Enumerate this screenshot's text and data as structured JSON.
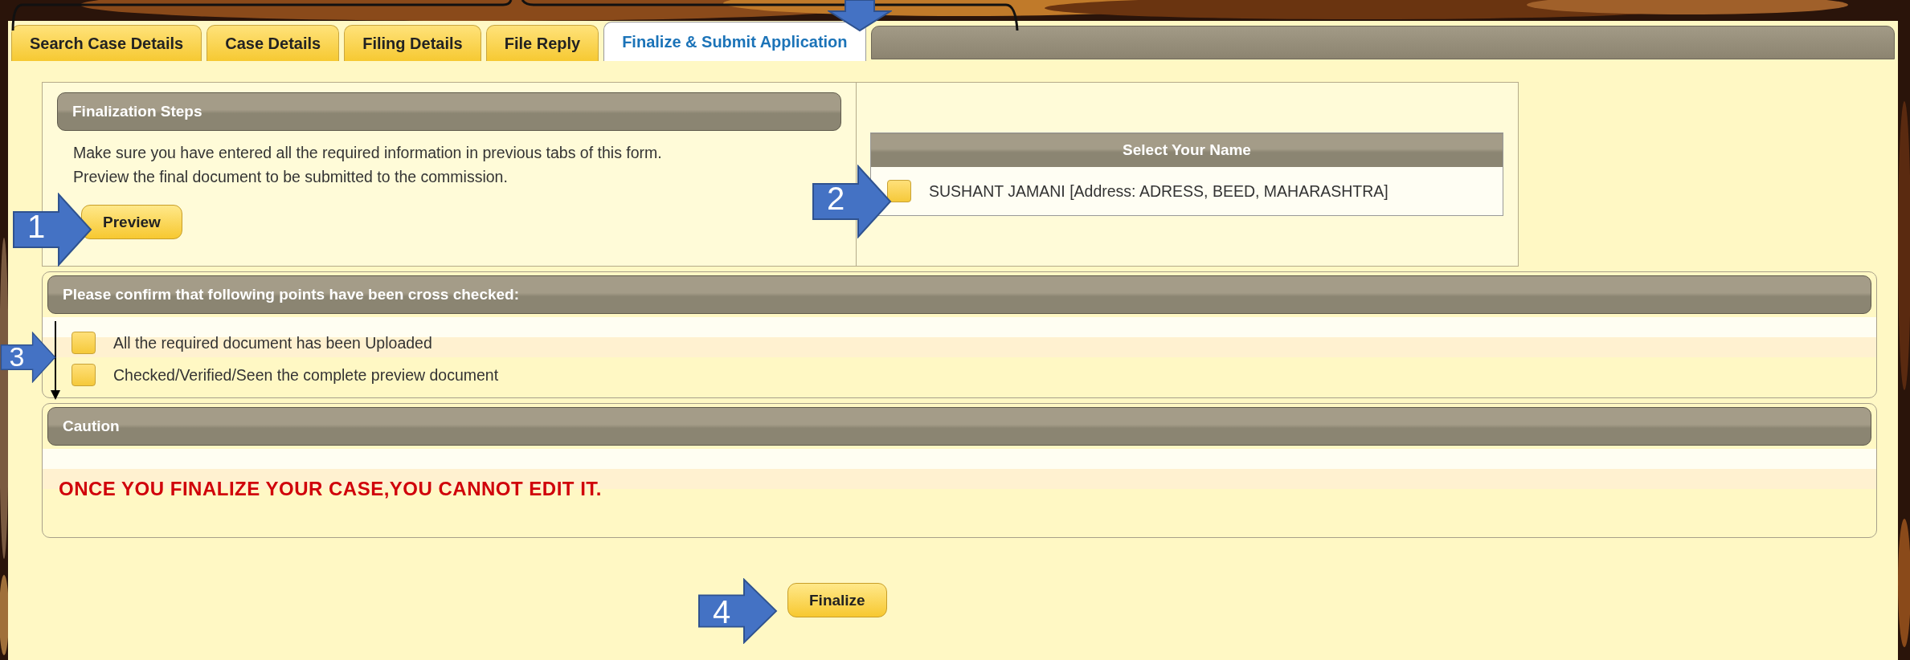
{
  "tabs": [
    {
      "label": "Search Case Details",
      "selected": false
    },
    {
      "label": "Case Details",
      "selected": false
    },
    {
      "label": "Filing Details",
      "selected": false
    },
    {
      "label": "File Reply",
      "selected": false
    },
    {
      "label": "Finalize & Submit Application",
      "selected": true
    }
  ],
  "finalization": {
    "title": "Finalization Steps",
    "lines": [
      "Make sure you have entered all the required information in previous tabs of this form.",
      "Preview the final document to be submitted to the commission."
    ],
    "button": "Preview"
  },
  "name_table": {
    "header": "Select Your Name",
    "rows": [
      {
        "label": "SUSHANT JAMANI [Address: ADRESS, BEED, MAHARASHTRA]",
        "checked": false
      }
    ]
  },
  "confirm": {
    "title": "Please confirm that following points have been cross checked:",
    "items": [
      {
        "label": "All the required document has been Uploaded",
        "checked": false
      },
      {
        "label": "Checked/Verified/Seen the complete preview document",
        "checked": false
      }
    ]
  },
  "caution": {
    "title": "Caution",
    "message": "ONCE YOU FINALIZE YOUR CASE,YOU CANNOT EDIT IT."
  },
  "finalize_button": "Finalize",
  "callouts": [
    "1",
    "2",
    "3",
    "4"
  ]
}
